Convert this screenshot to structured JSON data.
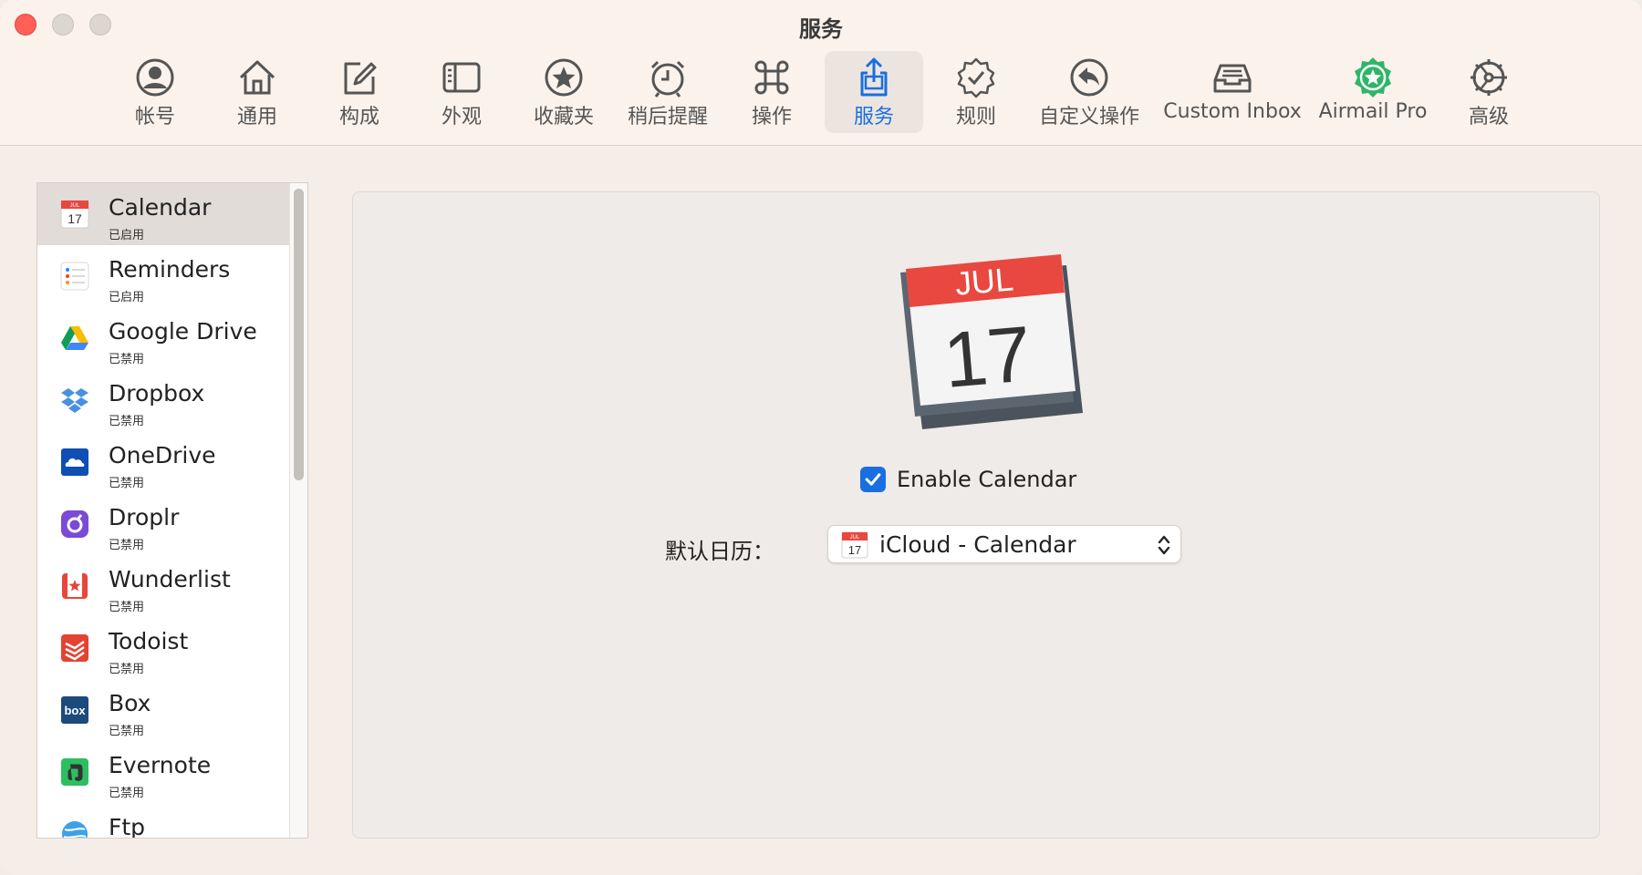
{
  "window": {
    "title": "服务"
  },
  "toolbar": {
    "tabs": [
      {
        "label": "帐号",
        "icon": "person-circle-icon"
      },
      {
        "label": "通用",
        "icon": "house-icon"
      },
      {
        "label": "构成",
        "icon": "compose-icon"
      },
      {
        "label": "外观",
        "icon": "sidebar-layout-icon"
      },
      {
        "label": "收藏夹",
        "icon": "star-circle-icon"
      },
      {
        "label": "稍后提醒",
        "icon": "alarm-clock-icon"
      },
      {
        "label": "操作",
        "icon": "command-key-icon"
      },
      {
        "label": "服务",
        "icon": "share-icon",
        "active": true
      },
      {
        "label": "规则",
        "icon": "checkmark-seal-icon"
      },
      {
        "label": "自定义操作",
        "icon": "reply-arrow-icon"
      },
      {
        "label": "Custom Inbox",
        "icon": "inbox-tray-icon"
      },
      {
        "label": "Airmail Pro",
        "icon": "airmail-pro-badge-icon"
      },
      {
        "label": "高级",
        "icon": "gear-icon"
      }
    ]
  },
  "sidebar": {
    "services": [
      {
        "name": "Calendar",
        "status": "已启用",
        "icon": "calendar-icon"
      },
      {
        "name": "Reminders",
        "status": "已启用",
        "icon": "reminders-icon"
      },
      {
        "name": "Google Drive",
        "status": "已禁用",
        "icon": "google-drive-icon"
      },
      {
        "name": "Dropbox",
        "status": "已禁用",
        "icon": "dropbox-icon"
      },
      {
        "name": "OneDrive",
        "status": "已禁用",
        "icon": "onedrive-icon"
      },
      {
        "name": "Droplr",
        "status": "已禁用",
        "icon": "droplr-icon"
      },
      {
        "name": "Wunderlist",
        "status": "已禁用",
        "icon": "wunderlist-icon"
      },
      {
        "name": "Todoist",
        "status": "已禁用",
        "icon": "todoist-icon"
      },
      {
        "name": "Box",
        "status": "已禁用",
        "icon": "box-icon"
      },
      {
        "name": "Evernote",
        "status": "已禁用",
        "icon": "evernote-icon"
      },
      {
        "name": "Ftp",
        "status": "",
        "icon": "ftp-globe-icon"
      }
    ],
    "selected_index": 0
  },
  "detail": {
    "calendar_month": "JUL",
    "calendar_day": "17",
    "enable_label": "Enable Calendar",
    "enable_checked": true,
    "default_calendar_label": "默认日历：",
    "default_calendar_value": "iCloud - Calendar",
    "mini_month": "JUL",
    "mini_day": "17"
  },
  "colors": {
    "accent": "#1a6fe0",
    "calendar_red": "#e8483f",
    "close_button": "#fe5f57"
  }
}
